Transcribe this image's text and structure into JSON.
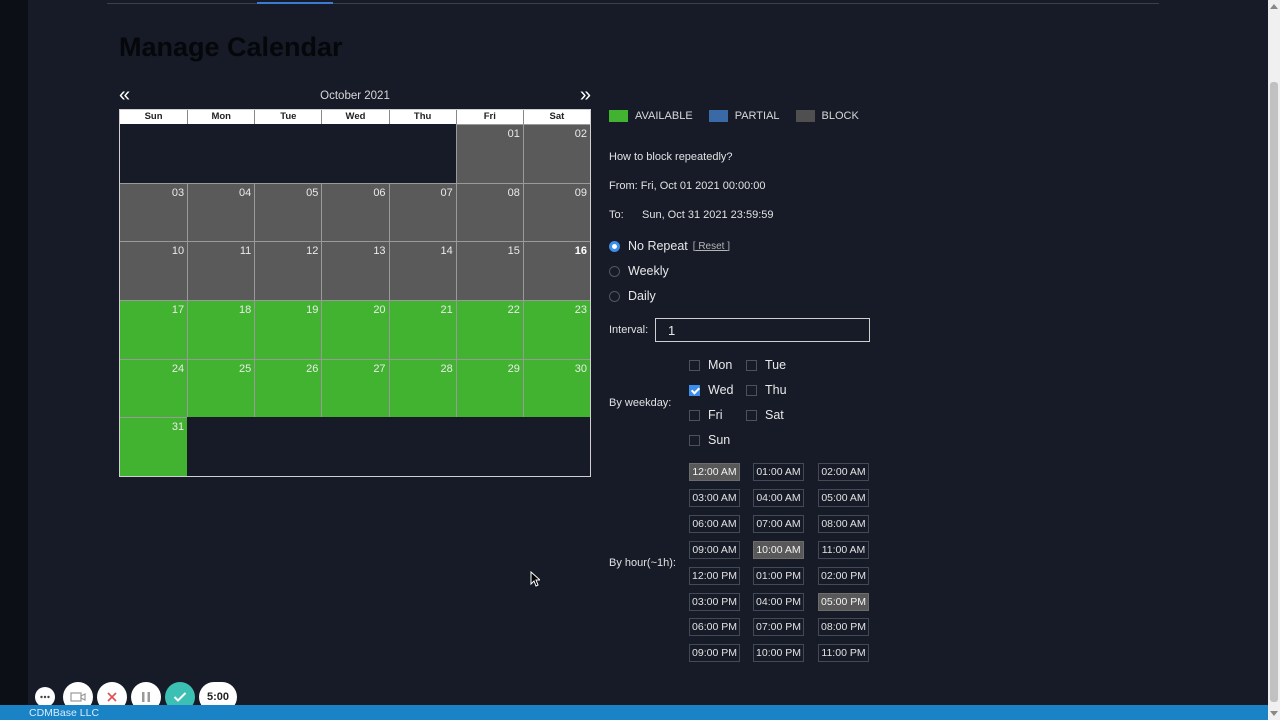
{
  "page": {
    "title": "Manage Calendar"
  },
  "calendar": {
    "month_label": "October 2021",
    "prev_icon": "«",
    "next_icon": "»",
    "weekdays": [
      "Sun",
      "Mon",
      "Tue",
      "Wed",
      "Thu",
      "Fri",
      "Sat"
    ],
    "today": "16",
    "days": [
      {
        "num": "01",
        "status": "block"
      },
      {
        "num": "02",
        "status": "block"
      },
      {
        "num": "03",
        "status": "block"
      },
      {
        "num": "04",
        "status": "block"
      },
      {
        "num": "05",
        "status": "block"
      },
      {
        "num": "06",
        "status": "block"
      },
      {
        "num": "07",
        "status": "block"
      },
      {
        "num": "08",
        "status": "block"
      },
      {
        "num": "09",
        "status": "block"
      },
      {
        "num": "10",
        "status": "block"
      },
      {
        "num": "11",
        "status": "block"
      },
      {
        "num": "12",
        "status": "block"
      },
      {
        "num": "13",
        "status": "block"
      },
      {
        "num": "14",
        "status": "block"
      },
      {
        "num": "15",
        "status": "block"
      },
      {
        "num": "16",
        "status": "block"
      },
      {
        "num": "17",
        "status": "available"
      },
      {
        "num": "18",
        "status": "available"
      },
      {
        "num": "19",
        "status": "available"
      },
      {
        "num": "20",
        "status": "available"
      },
      {
        "num": "21",
        "status": "available"
      },
      {
        "num": "22",
        "status": "available"
      },
      {
        "num": "23",
        "status": "available"
      },
      {
        "num": "24",
        "status": "available"
      },
      {
        "num": "25",
        "status": "available"
      },
      {
        "num": "26",
        "status": "available"
      },
      {
        "num": "27",
        "status": "available"
      },
      {
        "num": "28",
        "status": "available"
      },
      {
        "num": "29",
        "status": "available"
      },
      {
        "num": "30",
        "status": "available"
      },
      {
        "num": "31",
        "status": "available"
      }
    ],
    "leading_empty": 5
  },
  "legend": [
    {
      "label": "AVAILABLE",
      "color": "#42b331"
    },
    {
      "label": "PARTIAL",
      "color": "#3a6aa6"
    },
    {
      "label": "BLOCK",
      "color": "#4f4f4f"
    }
  ],
  "repeat": {
    "question": "How to block repeatedly?",
    "from_text": "From: Fri, Oct 01 2021 00:00:00",
    "to_label": "To:",
    "to_value": "Sun, Oct 31 2021 23:59:59",
    "options": [
      {
        "label": "No Repeat",
        "checked": true
      },
      {
        "label": "Weekly",
        "checked": false
      },
      {
        "label": "Daily",
        "checked": false
      }
    ],
    "reset_label": "[ Reset ]",
    "interval_label": "Interval:",
    "interval_value": "1",
    "weekday_label": "By weekday:",
    "weekdays": [
      {
        "label": "Mon",
        "checked": false
      },
      {
        "label": "Tue",
        "checked": false
      },
      {
        "label": "Wed",
        "checked": true
      },
      {
        "label": "Thu",
        "checked": false
      },
      {
        "label": "Fri",
        "checked": false
      },
      {
        "label": "Sat",
        "checked": false
      },
      {
        "label": "Sun",
        "checked": false
      }
    ],
    "hour_label": "By hour(~1h):",
    "hours": [
      {
        "label": "12:00 AM",
        "selected": true
      },
      {
        "label": "01:00 AM",
        "selected": false
      },
      {
        "label": "02:00 AM",
        "selected": false
      },
      {
        "label": "03:00 AM",
        "selected": false
      },
      {
        "label": "04:00 AM",
        "selected": false
      },
      {
        "label": "05:00 AM",
        "selected": false
      },
      {
        "label": "06:00 AM",
        "selected": false
      },
      {
        "label": "07:00 AM",
        "selected": false
      },
      {
        "label": "08:00 AM",
        "selected": false
      },
      {
        "label": "09:00 AM",
        "selected": false
      },
      {
        "label": "10:00 AM",
        "selected": true
      },
      {
        "label": "11:00 AM",
        "selected": false
      },
      {
        "label": "12:00 PM",
        "selected": false
      },
      {
        "label": "01:00 PM",
        "selected": false
      },
      {
        "label": "02:00 PM",
        "selected": false
      },
      {
        "label": "03:00 PM",
        "selected": false
      },
      {
        "label": "04:00 PM",
        "selected": false
      },
      {
        "label": "05:00 PM",
        "selected": true
      },
      {
        "label": "06:00 PM",
        "selected": false
      },
      {
        "label": "07:00 PM",
        "selected": false
      },
      {
        "label": "08:00 PM",
        "selected": false
      },
      {
        "label": "09:00 PM",
        "selected": false
      },
      {
        "label": "10:00 PM",
        "selected": false
      },
      {
        "label": "11:00 PM",
        "selected": false
      }
    ]
  },
  "footer": {
    "company": "CDMBase LLC"
  },
  "recorder": {
    "timer": "5:00",
    "accent": "#3cc0b4"
  }
}
